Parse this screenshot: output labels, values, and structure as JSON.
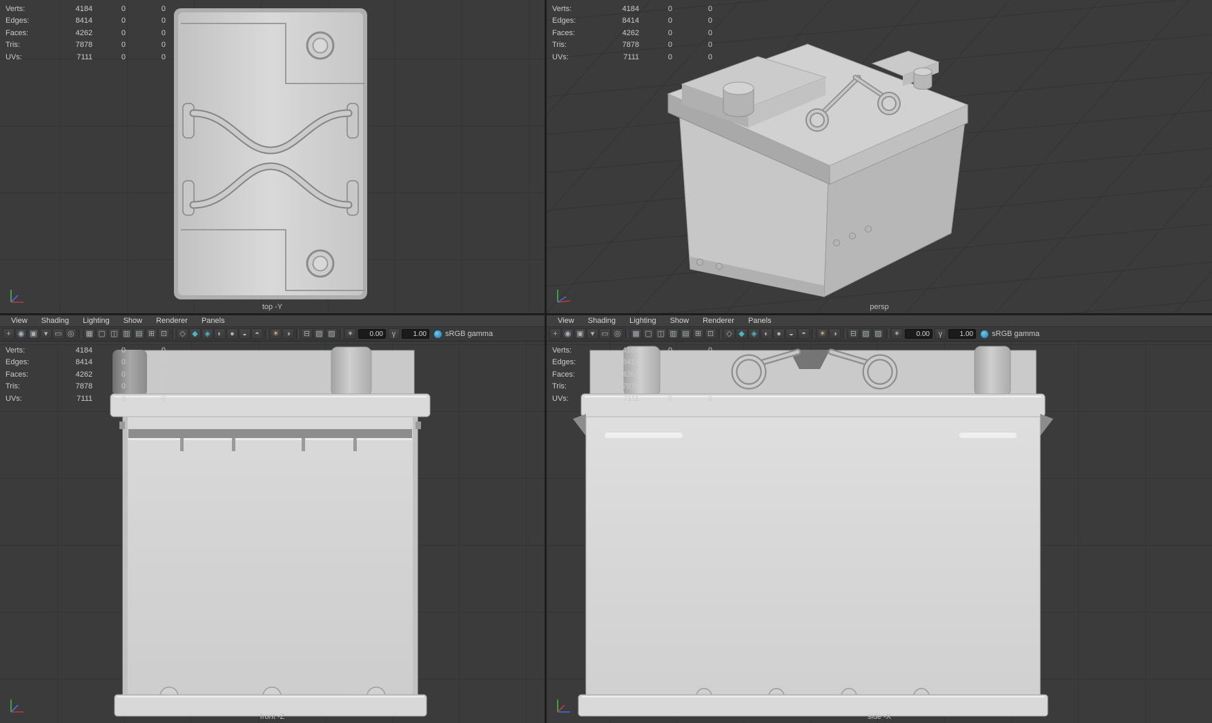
{
  "hud": {
    "rows": [
      {
        "label": "Verts:",
        "total": "4184",
        "selected": "0",
        "other": "0"
      },
      {
        "label": "Edges:",
        "total": "8414",
        "selected": "0",
        "other": "0"
      },
      {
        "label": "Faces:",
        "total": "4262",
        "selected": "0",
        "other": "0"
      },
      {
        "label": "Tris:",
        "total": "7878",
        "selected": "0",
        "other": "0"
      },
      {
        "label": "UVs:",
        "total": "7111",
        "selected": "0",
        "other": "0"
      }
    ]
  },
  "viewports": {
    "top": {
      "label": "top -Y"
    },
    "persp": {
      "label": "persp"
    },
    "front": {
      "label": "front -Z"
    },
    "side": {
      "label": "side -X"
    }
  },
  "panel_menu": {
    "items": [
      {
        "label": "View",
        "name": "menu-view"
      },
      {
        "label": "Shading",
        "name": "menu-shading"
      },
      {
        "label": "Lighting",
        "name": "menu-lighting"
      },
      {
        "label": "Show",
        "name": "menu-show"
      },
      {
        "label": "Renderer",
        "name": "menu-renderer"
      },
      {
        "label": "Panels",
        "name": "menu-panels"
      }
    ]
  },
  "panel_toolbar": {
    "icons": [
      {
        "name": "select-camera-icon",
        "glyph": "+"
      },
      {
        "name": "lock-camera-icon",
        "glyph": "◉"
      },
      {
        "name": "camera-attributes-icon",
        "glyph": "▣"
      },
      {
        "name": "bookmarks-icon",
        "glyph": "▾"
      },
      {
        "name": "image-plane-icon",
        "glyph": "▭"
      },
      {
        "name": "pan-zoom-icon",
        "glyph": "◎"
      },
      {
        "name": "toolbar-separator",
        "type": "sep",
        "glyph": "",
        "interactable": false
      },
      {
        "name": "grid-icon",
        "glyph": "▦"
      },
      {
        "name": "film-gate-icon",
        "glyph": "▢"
      },
      {
        "name": "resolution-gate-icon",
        "glyph": "◫"
      },
      {
        "name": "gate-mask-icon",
        "glyph": "▥"
      },
      {
        "name": "field-chart-icon",
        "glyph": "▤"
      },
      {
        "name": "safe-action-icon",
        "glyph": "⊞"
      },
      {
        "name": "safe-title-icon",
        "glyph": "⊡"
      },
      {
        "name": "toolbar-separator",
        "type": "sep",
        "glyph": "",
        "interactable": false
      },
      {
        "name": "wireframe-icon",
        "glyph": "◇"
      },
      {
        "name": "smooth-shade-icon",
        "glyph": "◆",
        "color": "#49b8c8"
      },
      {
        "name": "textured-icon",
        "glyph": "◈",
        "color": "#49b8c8"
      },
      {
        "name": "use-default-material-icon",
        "glyph": "◐"
      },
      {
        "name": "shadows-icon",
        "glyph": "●"
      },
      {
        "name": "ambient-occlusion-icon",
        "glyph": "◒"
      },
      {
        "name": "motion-blur-icon",
        "glyph": "◓"
      },
      {
        "name": "toolbar-separator",
        "type": "sep",
        "glyph": "",
        "interactable": false
      },
      {
        "name": "lights-icon",
        "glyph": "☀",
        "color": "#d8c06a"
      },
      {
        "name": "shadows-toggle-icon",
        "glyph": "◑"
      },
      {
        "name": "toolbar-separator",
        "type": "sep",
        "glyph": "",
        "interactable": false
      },
      {
        "name": "isolate-select-icon",
        "glyph": "⊟"
      },
      {
        "name": "xray-icon",
        "glyph": "▧"
      },
      {
        "name": "xray-joints-icon",
        "glyph": "▨"
      },
      {
        "name": "toolbar-separator",
        "type": "sep",
        "glyph": "",
        "interactable": false
      }
    ],
    "exposure_icon": "✶",
    "exposure_value": "0.00",
    "gamma_icon": "γ",
    "gamma_value": "1.00",
    "colorspace_label": "sRGB gamma"
  },
  "colors": {
    "viewport_bg": "#3b3b3b",
    "grid_line": "#343434",
    "model_light": "#d4d4d4",
    "accent_teal": "#49b8c8",
    "axis_x": "#c03a3a",
    "axis_y": "#3ac03a",
    "axis_z": "#4a6ae0"
  }
}
